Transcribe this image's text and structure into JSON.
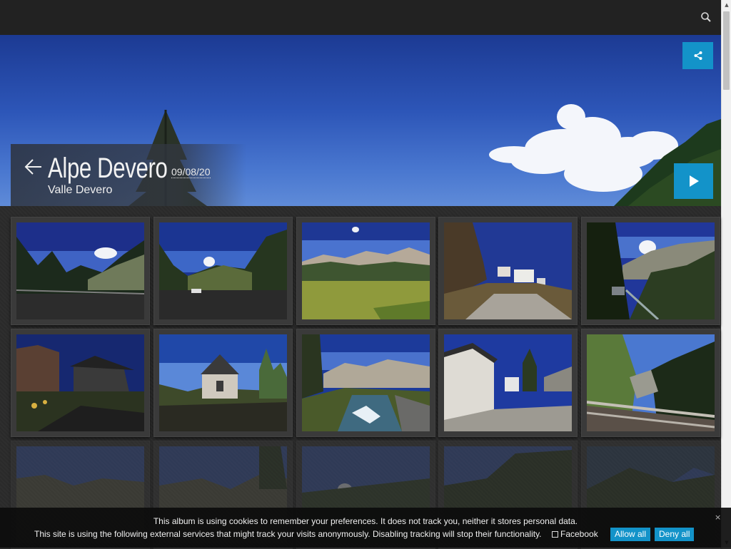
{
  "header": {
    "search_icon": "search-icon"
  },
  "hero": {
    "title": "Alpe Devero",
    "date": "09/08/20",
    "subtitle": "Valle Devero",
    "share_icon": "share-icon",
    "play_icon": "play-icon",
    "back_icon": "arrow-left-icon"
  },
  "thumbnails": {
    "count_visible_rows": 3,
    "icons": [
      "mountain-photo"
    ]
  },
  "cookie": {
    "line1": "This album is using cookies to remember your preferences. It does not track you, neither it stores personal data.",
    "line2": "This site is using the following external services that might track your visits anonymously. Disabling tracking will stop their functionality.",
    "facebook_label": "Facebook",
    "allow_label": "Allow all",
    "deny_label": "Deny all",
    "close_glyph": "×"
  },
  "colors": {
    "accent": "#1393c9",
    "topbar": "#222222",
    "background": "#2a2a2a"
  }
}
